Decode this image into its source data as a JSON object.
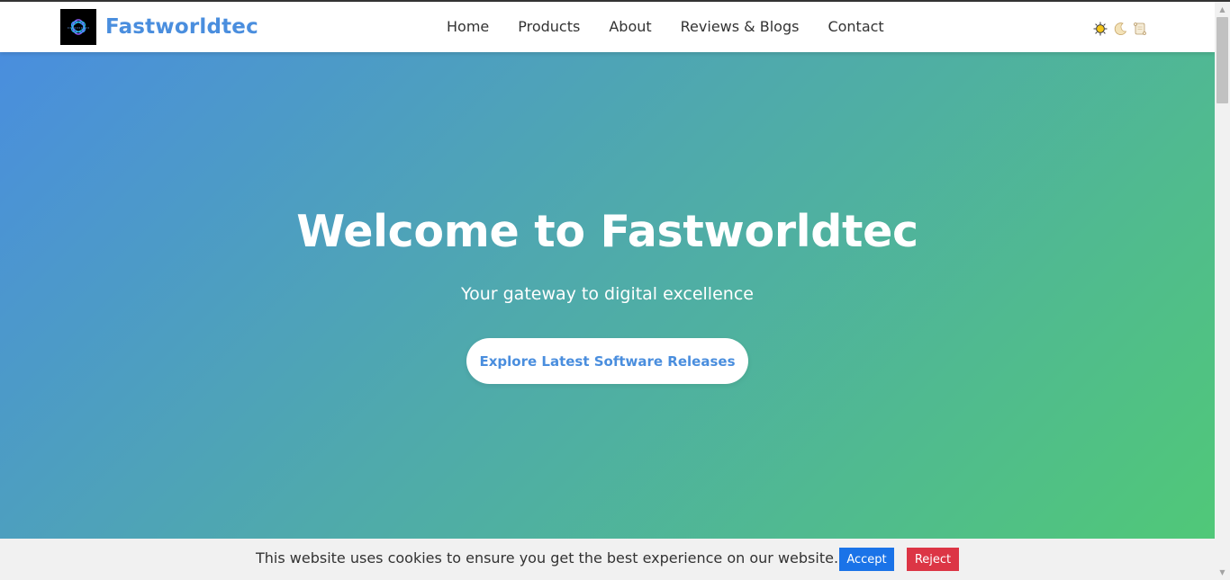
{
  "header": {
    "brand": "Fastworldtec",
    "nav": [
      "Home",
      "Products",
      "About",
      "Reviews & Blogs",
      "Contact"
    ],
    "theme_icons": [
      "sun-icon",
      "moon-icon",
      "scroll-icon"
    ]
  },
  "hero": {
    "title": "Welcome to Fastworldtec",
    "subtitle": "Your gateway to digital excellence",
    "cta_label": "Explore Latest Software Releases"
  },
  "cookie": {
    "text": "This website uses cookies to ensure you get the best experience on our website.",
    "accept_label": "Accept",
    "reject_label": "Reject"
  },
  "colors": {
    "brand": "#4a8ede",
    "gradient_start": "#4a8ede",
    "gradient_end": "#50c878",
    "accept": "#1a73e8",
    "reject": "#dc3545"
  }
}
